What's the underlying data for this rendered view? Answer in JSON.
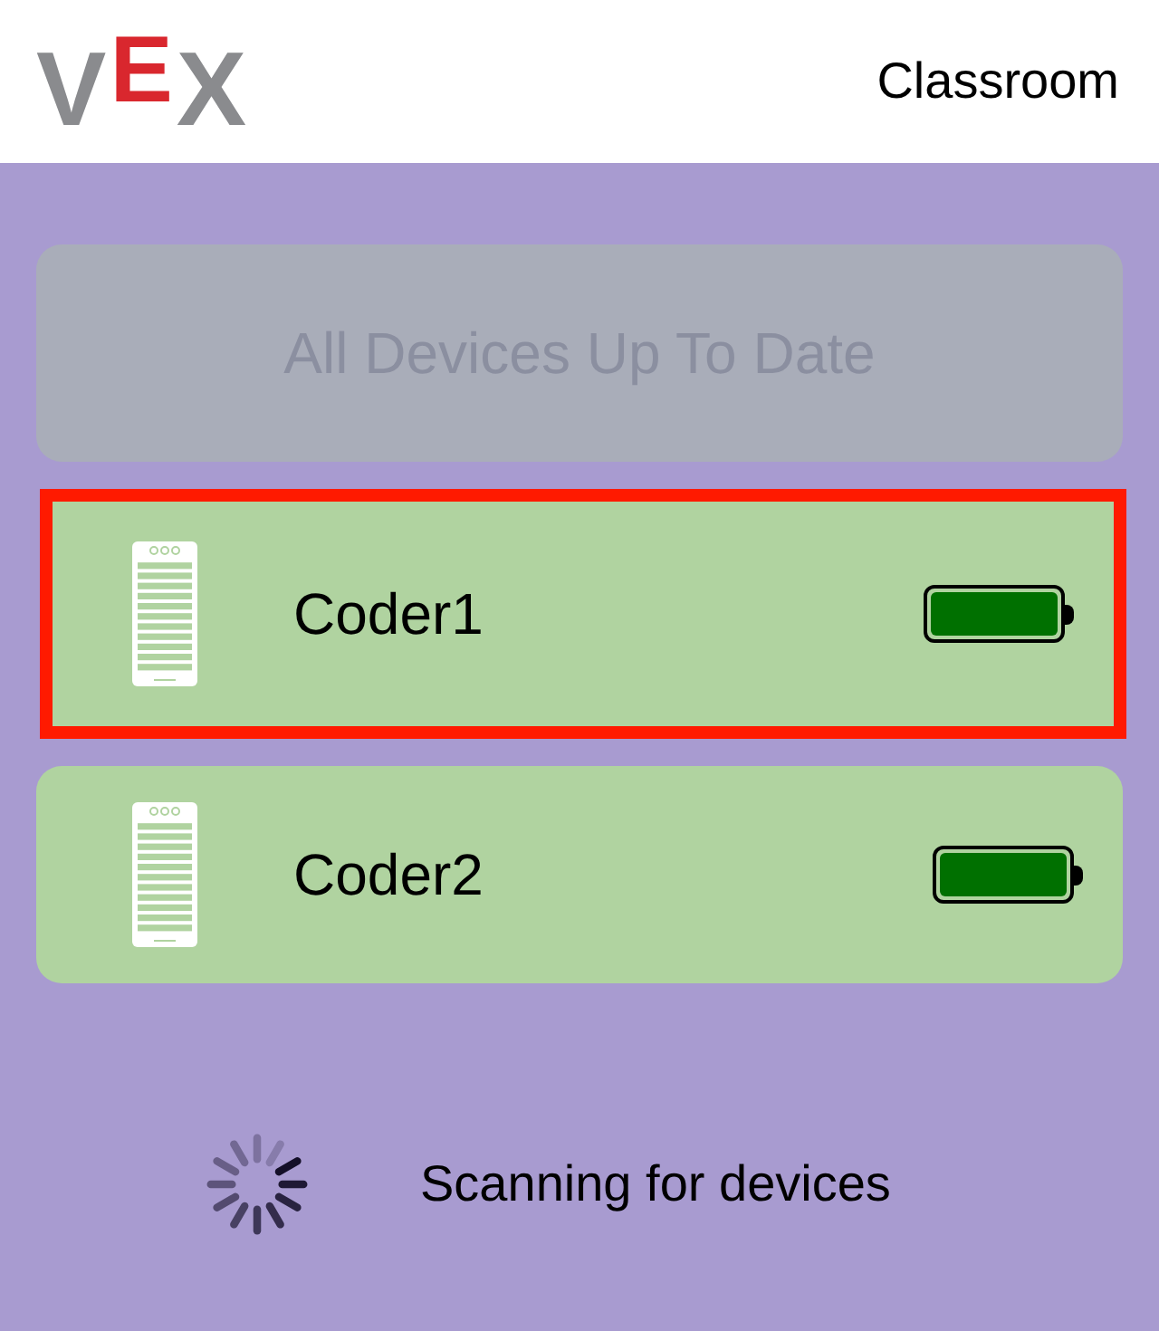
{
  "header": {
    "logo": "VEX",
    "title": "Classroom"
  },
  "update_button": {
    "label": "All Devices Up To Date",
    "disabled": true
  },
  "devices": [
    {
      "name": "Coder1",
      "selected": true,
      "level": 1
    },
    {
      "name": "Coder2",
      "selected": false,
      "level": 1
    }
  ],
  "status": {
    "text": "Scanning for devices"
  }
}
